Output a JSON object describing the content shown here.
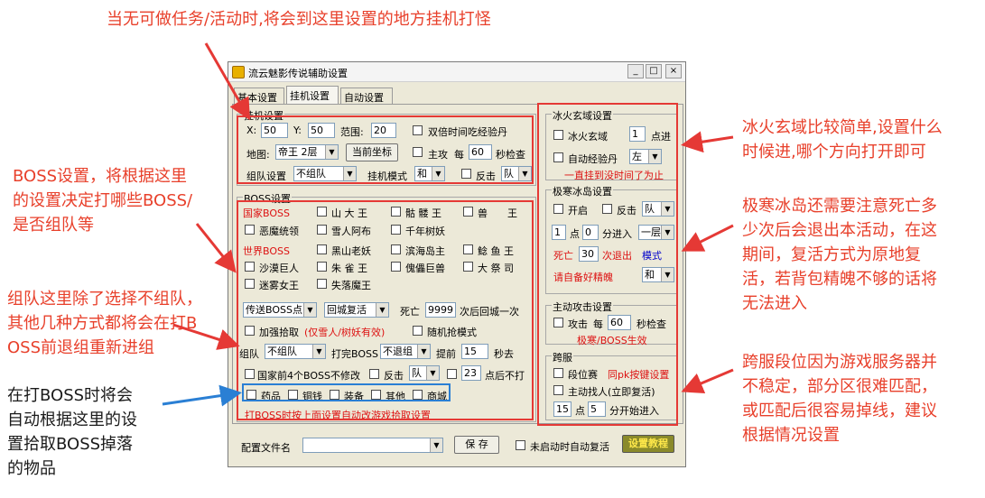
{
  "window": {
    "title": "流云魅影传说辅助设置",
    "min_label": "_",
    "max_label": "□",
    "close_label": "×"
  },
  "tabs": [
    {
      "label": "基本设置"
    },
    {
      "label": "挂机设置"
    },
    {
      "label": "自动设置"
    }
  ],
  "hangup": {
    "group_label": "挂机设置",
    "x_label": "X:",
    "x_value": "50",
    "y_label": "Y:",
    "y_value": "50",
    "range_label": "范围:",
    "range_value": "20",
    "double_exp_label": "双倍时间吃经验丹",
    "map_label": "地图:",
    "map_value": "帝王 2层",
    "current_coord_button": "当前坐标",
    "main_label": "主攻",
    "every_label": "每",
    "every_value": "60",
    "sec_check_label": "秒检查",
    "team_label": "组队设置",
    "team_value": "不组队",
    "mode_label": "挂机模式",
    "mode_value": "和",
    "counter_label": "反击",
    "counter_value": "队"
  },
  "boss": {
    "group_label": "BOSS设置",
    "national_header": "国家BOSS",
    "national": [
      "山 大 王",
      "骷 髅 王",
      "兽　　王",
      "恶魔统领",
      "雪人阿布",
      "千年树妖"
    ],
    "world_header": "世界BOSS",
    "world": [
      "黑山老妖",
      "滨海岛主",
      "鲶 鱼 王",
      "沙漠巨人",
      "朱 雀 王",
      "傀儡巨兽",
      "大 祭 司",
      "迷雾女王",
      "失落魔王"
    ],
    "teleport_value": "传送BOSS点",
    "revive_value": "回城复活",
    "death_label": "死亡",
    "death_value": "9999",
    "after_return_label": "次后回城一次",
    "enhance_pick_label": "加强拾取",
    "enhance_pick_note": "(仅雪人/树妖有效)",
    "random_pick_label": "随机抢模式",
    "team_label": "组队",
    "team_value": "不组队",
    "after_kill_label": "打完BOSS",
    "after_kill_value": "不退组",
    "advance_label": "提前",
    "advance_value": "15",
    "sec_label": "秒去",
    "no_repair_label": "国家前4个BOSS不修改",
    "counter_label": "反击",
    "counter_value": "队",
    "no_fight_value": "23",
    "no_fight_label": "点后不打",
    "pickup_items": [
      "药品",
      "铜钱",
      "装备",
      "其他",
      "商城"
    ],
    "pickup_note": "打BOSS时按上面设置自动改游戏拾取设置"
  },
  "ice_fire": {
    "group_label": "冰火玄域设置",
    "enter_label": "冰火玄域",
    "enter_value": "1",
    "enter_suffix": "点进",
    "exp_label": "自动经验丹",
    "exp_value": "左",
    "note": "一直挂到没时间了为止"
  },
  "ice_island": {
    "group_label": "极寒冰岛设置",
    "open_label": "开启",
    "counter_label": "反击",
    "counter_value": "队",
    "hour_value": "1",
    "point_label": "点",
    "min_value": "0",
    "enter_label": "分进入",
    "floor_value": "一层",
    "death_label": "死亡",
    "death_value": "30",
    "exit_label": "次退出",
    "mode_label": "模式",
    "soul_note": "请自备好精魄",
    "mode_value": "和"
  },
  "active_attack": {
    "group_label": "主动攻击设置",
    "attack_label": "攻击",
    "every_label": "每",
    "every_value": "60",
    "sec_check_label": "秒检查",
    "note": "极寒/BOSS生效"
  },
  "cross": {
    "group_label": "跨服",
    "rank_label": "段位赛",
    "rank_note": "同pk按键设置",
    "find_label": "主动找人(立即复活)",
    "hour_value": "15",
    "point_label": "点",
    "min_value": "5",
    "start_label": "分开始进入"
  },
  "bottom": {
    "config_label": "配置文件名",
    "save_button": "保 存",
    "auto_revive_label": "未启动时自动复活",
    "tutorial_button": "设置教程"
  },
  "notes": {
    "top": "当无可做任务/活动时,将会到这里设置的地方挂机打怪",
    "boss": [
      "BOSS设置，将根据这里",
      "的设置决定打哪些BOSS/",
      "是否组队等"
    ],
    "team": [
      "组队这里除了选择不组队，",
      "其他几种方式都将会在打B",
      "OSS前退组重新进组"
    ],
    "pickup": [
      "在打BOSS时将会",
      "自动根据这里的设",
      "置拾取BOSS掉落",
      "的物品"
    ],
    "ice_fire": [
      "冰火玄域比较简单,设置什么",
      "时候进,哪个方向打开即可"
    ],
    "ice_island": [
      "极寒冰岛还需要注意死亡多",
      "少次后会退出本活动，在这",
      "期间，复活方式为原地复",
      "活，若背包精魄不够的话将",
      "无法进入"
    ],
    "cross": [
      "跨服段位因为游戏服务器并",
      "不稳定，部分区很难匹配，",
      "或匹配后很容易掉线，建议",
      "根据情况设置"
    ]
  },
  "colors": {
    "annotation_red": "#e8402b",
    "annotation_blue": "#2a7fd4",
    "box_red": "#e53935"
  }
}
